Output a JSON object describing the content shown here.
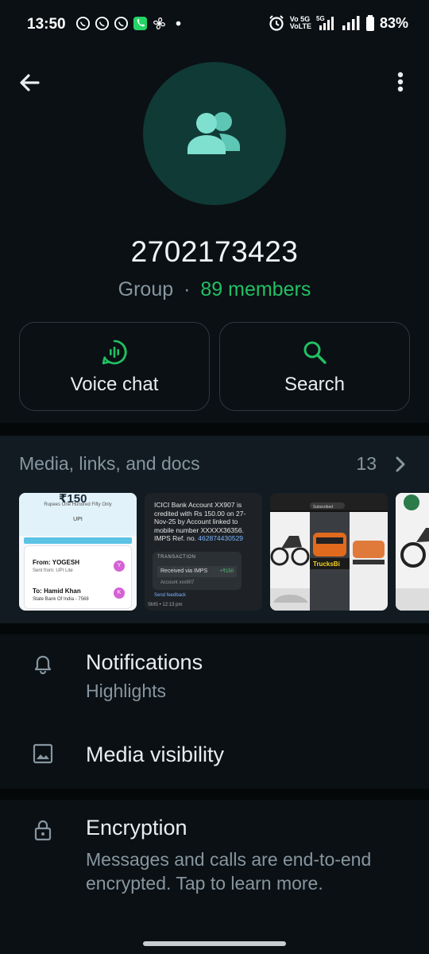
{
  "status_bar": {
    "time": "13:50",
    "network_line1": "Vo 5G",
    "network_line2": "VoLTE",
    "network_label": "5G",
    "battery": "83%",
    "icons": [
      "whatsapp-icon",
      "whatsapp-icon",
      "whatsapp-business-icon",
      "phone-call-icon",
      "fan-icon",
      "dot-icon",
      "alarm-icon",
      "signal-icon",
      "signal-icon",
      "battery-icon"
    ]
  },
  "header": {
    "back_icon": "arrow-back-icon",
    "more_icon": "more-vert-icon",
    "avatar_icon": "group-icon",
    "group_name": "2702173423",
    "group_label": "Group",
    "separator": "·",
    "members": "89 members",
    "accent_color": "#21c063"
  },
  "actions": [
    {
      "label": "Voice chat",
      "icon": "voice-chat-icon"
    },
    {
      "label": "Search",
      "icon": "search-icon"
    }
  ],
  "media": {
    "title": "Media, links, and docs",
    "count": "13",
    "chevron_icon": "chevron-right-icon",
    "thumb1": {
      "amount": "₹150",
      "rupees_text": "Rupees One Hundred Fifty Only",
      "upi_label": "UPI",
      "from": "From: YOGESH",
      "sent_from": "Sent from: UPI Lite",
      "from_initial": "Y",
      "to": "To: Hamid Khan",
      "bank": "State Bank Of India - 7568",
      "to_initial": "K"
    },
    "thumb2": {
      "sms_line1": "ICICI Bank Account XX907 is credited with Rs 150.00 on 27-Nov-25 by Account linked to mobile number XXXXX36356. IMPS Ref. no.",
      "sms_ref": "462874430529",
      "tx_header": "TRANSACTION",
      "tx_label": "Received via IMPS",
      "tx_amount": "+₹150",
      "tx_account": "Account xxx907",
      "feedback": "Send feedback",
      "footer": "SMS • 12:13 pm"
    },
    "thumb3": {
      "subscribe": "Subscribed",
      "banner": "TrucksBi"
    }
  },
  "settings": {
    "notifications": {
      "title": "Notifications",
      "subtitle": "Highlights",
      "icon": "bell-icon"
    },
    "media_visibility": {
      "title": "Media visibility",
      "icon": "image-icon"
    }
  },
  "encryption": {
    "title": "Encryption",
    "text": "Messages and calls are end-to-end encrypted. Tap to learn more.",
    "icon": "lock-icon"
  }
}
